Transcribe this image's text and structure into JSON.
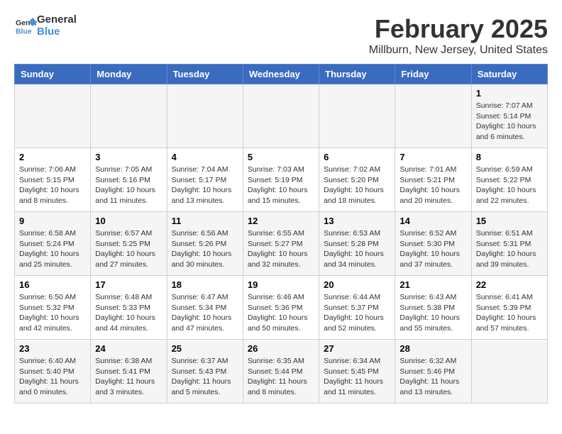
{
  "logo": {
    "text_general": "General",
    "text_blue": "Blue"
  },
  "header": {
    "title": "February 2025",
    "subtitle": "Millburn, New Jersey, United States"
  },
  "days_of_week": [
    "Sunday",
    "Monday",
    "Tuesday",
    "Wednesday",
    "Thursday",
    "Friday",
    "Saturday"
  ],
  "weeks": [
    [
      {
        "day": "",
        "info": ""
      },
      {
        "day": "",
        "info": ""
      },
      {
        "day": "",
        "info": ""
      },
      {
        "day": "",
        "info": ""
      },
      {
        "day": "",
        "info": ""
      },
      {
        "day": "",
        "info": ""
      },
      {
        "day": "1",
        "info": "Sunrise: 7:07 AM\nSunset: 5:14 PM\nDaylight: 10 hours and 6 minutes."
      }
    ],
    [
      {
        "day": "2",
        "info": "Sunrise: 7:06 AM\nSunset: 5:15 PM\nDaylight: 10 hours and 8 minutes."
      },
      {
        "day": "3",
        "info": "Sunrise: 7:05 AM\nSunset: 5:16 PM\nDaylight: 10 hours and 11 minutes."
      },
      {
        "day": "4",
        "info": "Sunrise: 7:04 AM\nSunset: 5:17 PM\nDaylight: 10 hours and 13 minutes."
      },
      {
        "day": "5",
        "info": "Sunrise: 7:03 AM\nSunset: 5:19 PM\nDaylight: 10 hours and 15 minutes."
      },
      {
        "day": "6",
        "info": "Sunrise: 7:02 AM\nSunset: 5:20 PM\nDaylight: 10 hours and 18 minutes."
      },
      {
        "day": "7",
        "info": "Sunrise: 7:01 AM\nSunset: 5:21 PM\nDaylight: 10 hours and 20 minutes."
      },
      {
        "day": "8",
        "info": "Sunrise: 6:59 AM\nSunset: 5:22 PM\nDaylight: 10 hours and 22 minutes."
      }
    ],
    [
      {
        "day": "9",
        "info": "Sunrise: 6:58 AM\nSunset: 5:24 PM\nDaylight: 10 hours and 25 minutes."
      },
      {
        "day": "10",
        "info": "Sunrise: 6:57 AM\nSunset: 5:25 PM\nDaylight: 10 hours and 27 minutes."
      },
      {
        "day": "11",
        "info": "Sunrise: 6:56 AM\nSunset: 5:26 PM\nDaylight: 10 hours and 30 minutes."
      },
      {
        "day": "12",
        "info": "Sunrise: 6:55 AM\nSunset: 5:27 PM\nDaylight: 10 hours and 32 minutes."
      },
      {
        "day": "13",
        "info": "Sunrise: 6:53 AM\nSunset: 5:28 PM\nDaylight: 10 hours and 34 minutes."
      },
      {
        "day": "14",
        "info": "Sunrise: 6:52 AM\nSunset: 5:30 PM\nDaylight: 10 hours and 37 minutes."
      },
      {
        "day": "15",
        "info": "Sunrise: 6:51 AM\nSunset: 5:31 PM\nDaylight: 10 hours and 39 minutes."
      }
    ],
    [
      {
        "day": "16",
        "info": "Sunrise: 6:50 AM\nSunset: 5:32 PM\nDaylight: 10 hours and 42 minutes."
      },
      {
        "day": "17",
        "info": "Sunrise: 6:48 AM\nSunset: 5:33 PM\nDaylight: 10 hours and 44 minutes."
      },
      {
        "day": "18",
        "info": "Sunrise: 6:47 AM\nSunset: 5:34 PM\nDaylight: 10 hours and 47 minutes."
      },
      {
        "day": "19",
        "info": "Sunrise: 6:46 AM\nSunset: 5:36 PM\nDaylight: 10 hours and 50 minutes."
      },
      {
        "day": "20",
        "info": "Sunrise: 6:44 AM\nSunset: 5:37 PM\nDaylight: 10 hours and 52 minutes."
      },
      {
        "day": "21",
        "info": "Sunrise: 6:43 AM\nSunset: 5:38 PM\nDaylight: 10 hours and 55 minutes."
      },
      {
        "day": "22",
        "info": "Sunrise: 6:41 AM\nSunset: 5:39 PM\nDaylight: 10 hours and 57 minutes."
      }
    ],
    [
      {
        "day": "23",
        "info": "Sunrise: 6:40 AM\nSunset: 5:40 PM\nDaylight: 11 hours and 0 minutes."
      },
      {
        "day": "24",
        "info": "Sunrise: 6:38 AM\nSunset: 5:41 PM\nDaylight: 11 hours and 3 minutes."
      },
      {
        "day": "25",
        "info": "Sunrise: 6:37 AM\nSunset: 5:43 PM\nDaylight: 11 hours and 5 minutes."
      },
      {
        "day": "26",
        "info": "Sunrise: 6:35 AM\nSunset: 5:44 PM\nDaylight: 11 hours and 8 minutes."
      },
      {
        "day": "27",
        "info": "Sunrise: 6:34 AM\nSunset: 5:45 PM\nDaylight: 11 hours and 11 minutes."
      },
      {
        "day": "28",
        "info": "Sunrise: 6:32 AM\nSunset: 5:46 PM\nDaylight: 11 hours and 13 minutes."
      },
      {
        "day": "",
        "info": ""
      }
    ]
  ]
}
